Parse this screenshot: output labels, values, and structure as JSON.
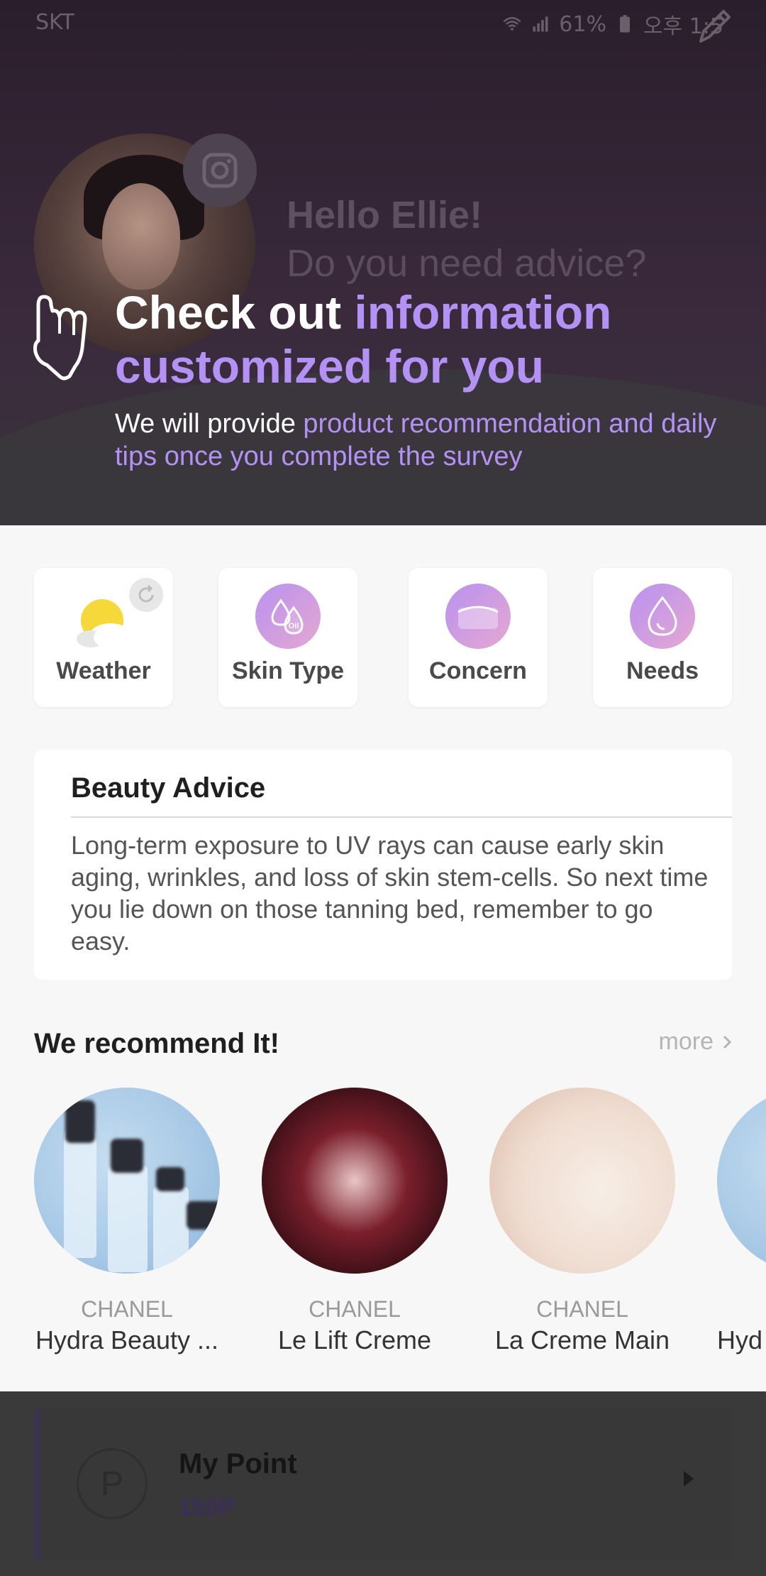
{
  "status_bar": {
    "carrier": "SKT",
    "battery": "61%",
    "time": "오후 1:5"
  },
  "profile": {
    "greeting": "Hello Ellie!",
    "question": "Do you need advice?"
  },
  "banner": {
    "headline_white": "Check out ",
    "headline_accent1": "information",
    "headline_accent2": "customized for you",
    "sub_white": "We will provide ",
    "sub_accent": "product recommendation and daily tips once you complete the survey"
  },
  "survey_cards": [
    {
      "label": "Weather",
      "icon": "weather-icon"
    },
    {
      "label": "Skin Type",
      "icon": "oil-drop-icon"
    },
    {
      "label": "Concern",
      "icon": "concern-icon"
    },
    {
      "label": "Needs",
      "icon": "drop-icon"
    }
  ],
  "advice": {
    "title": "Beauty Advice",
    "text": "Long-term exposure to UV rays can cause early skin  aging, wrinkles, and loss of skin stem-cells. So next time you lie down on those tanning bed, remember to go easy."
  },
  "recommend": {
    "title": "We recommend It!",
    "more_label": "more",
    "products": [
      {
        "brand": "CHANEL",
        "name": "Hydra Beauty ..."
      },
      {
        "brand": "CHANEL",
        "name": "Le Lift Creme"
      },
      {
        "brand": "CHANEL",
        "name": "La Creme Main"
      },
      {
        "brand": "",
        "name": "Hyd"
      }
    ]
  },
  "points": {
    "title": "My Point",
    "value": "150P",
    "icon_letter": "P"
  },
  "colors": {
    "accent": "#b491f4",
    "icon_gradient_start": "#b891ef",
    "icon_gradient_end": "#e6a8d2"
  }
}
